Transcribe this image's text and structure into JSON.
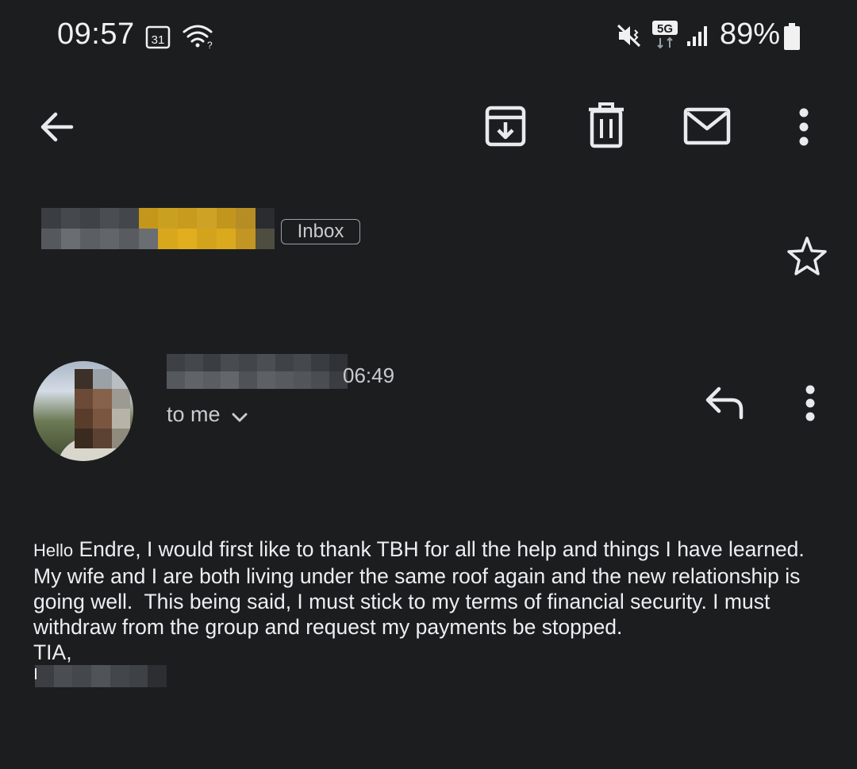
{
  "status_bar": {
    "time": "09:57",
    "calendar_day": "31",
    "network": "5G",
    "battery": "89%"
  },
  "toolbar": {
    "icons": [
      "back-arrow-icon",
      "archive-icon",
      "delete-icon",
      "mark-unread-icon",
      "more-vert-icon"
    ]
  },
  "subject": {
    "label": "Inbox"
  },
  "message": {
    "time_fragment": "06:49",
    "recipient": "to me",
    "greeting": "Hello",
    "body": " Endre, I would first like to thank TBH for all the help and things I have learned.\nMy wife and I are both living under the same roof again and the new relationship is\ngoing well.  This being said, I must stick to my terms of financial security. I must\nwithdraw from the group and request my payments be stopped.\nTIA,"
  },
  "colors": {
    "background": "#1c1d1f",
    "text": "#e8eaed",
    "secondary_text": "#c8cacd"
  }
}
